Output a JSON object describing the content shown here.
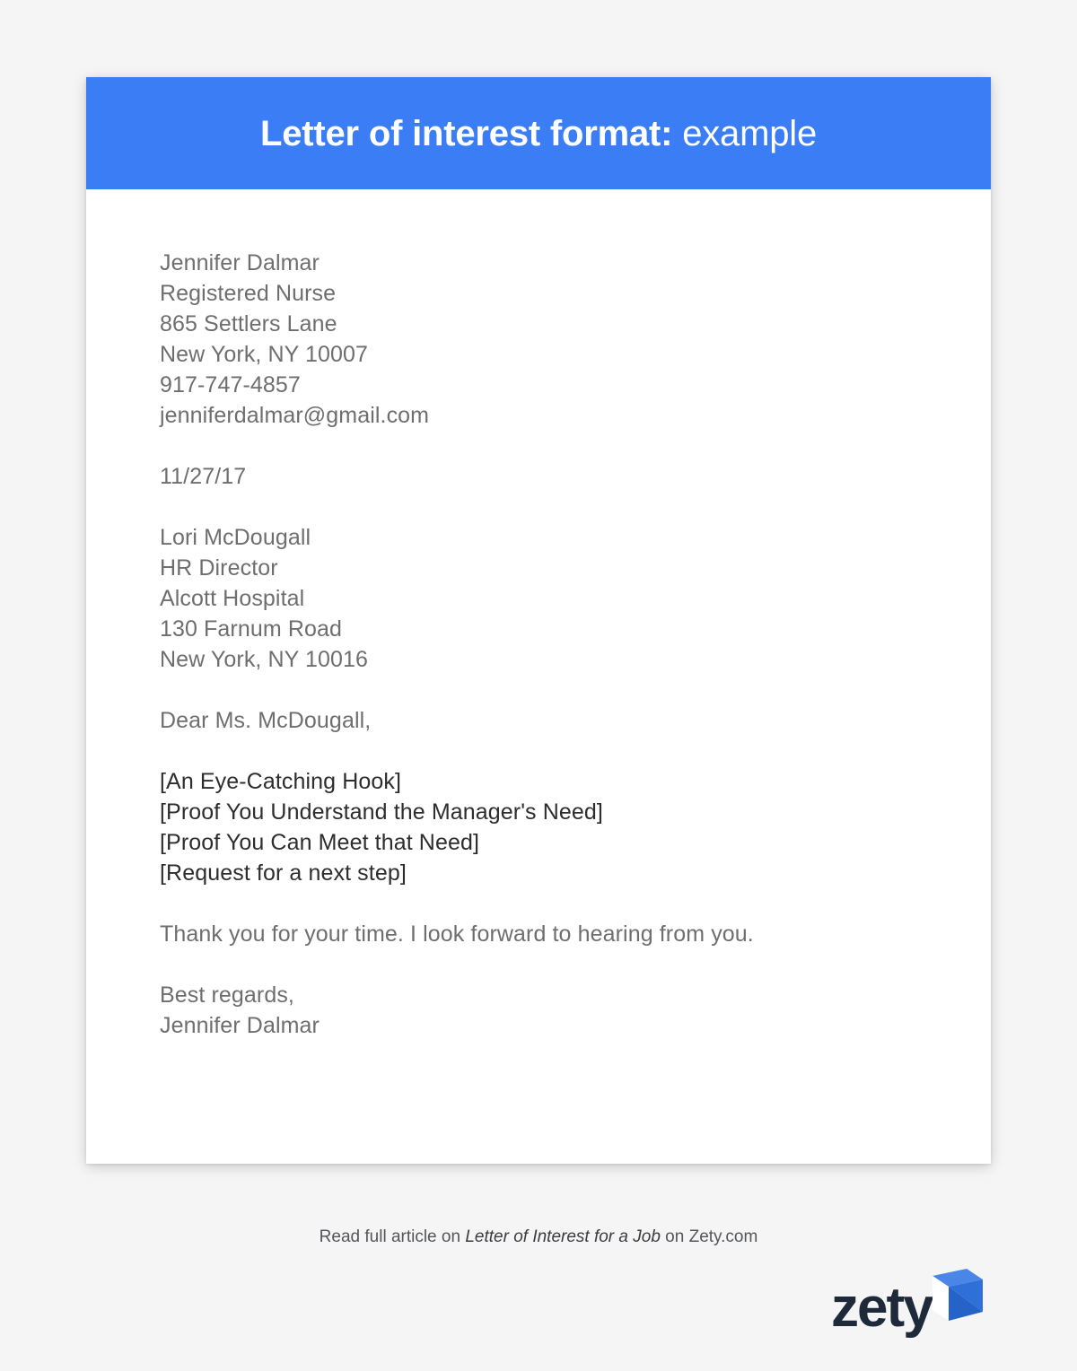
{
  "header": {
    "title_strong": "Letter of interest format:",
    "title_light": " example",
    "bar_color": "#3b7df5"
  },
  "letter": {
    "sender": [
      "Jennifer Dalmar",
      "Registered Nurse",
      "865 Settlers Lane",
      "New York, NY 10007",
      "917-747-4857",
      "jenniferdalmar@gmail.com"
    ],
    "date": "11/27/17",
    "recipient": [
      "Lori McDougall",
      "HR Director",
      "Alcott Hospital",
      "130 Farnum Road",
      "New York, NY 10016"
    ],
    "salutation": "Dear Ms. McDougall,",
    "body_placeholders": [
      "[An Eye-Catching Hook]",
      "[Proof You Understand the Manager's Need]",
      "[Proof You Can Meet that Need]",
      "[Request for a next step]"
    ],
    "closing_sentence": "Thank you for your time. I look forward to hearing from you.",
    "signoff": [
      "Best regards,",
      "Jennifer Dalmar"
    ]
  },
  "footer": {
    "prefix": "Read full article on ",
    "article_title": "Letter of Interest for a Job",
    "suffix": " on Zety.com"
  },
  "logo": {
    "wordmark": "zety",
    "mark_color_light": "#4a86e8",
    "mark_color_dark": "#2563c9",
    "word_color": "#1e2a3a"
  }
}
